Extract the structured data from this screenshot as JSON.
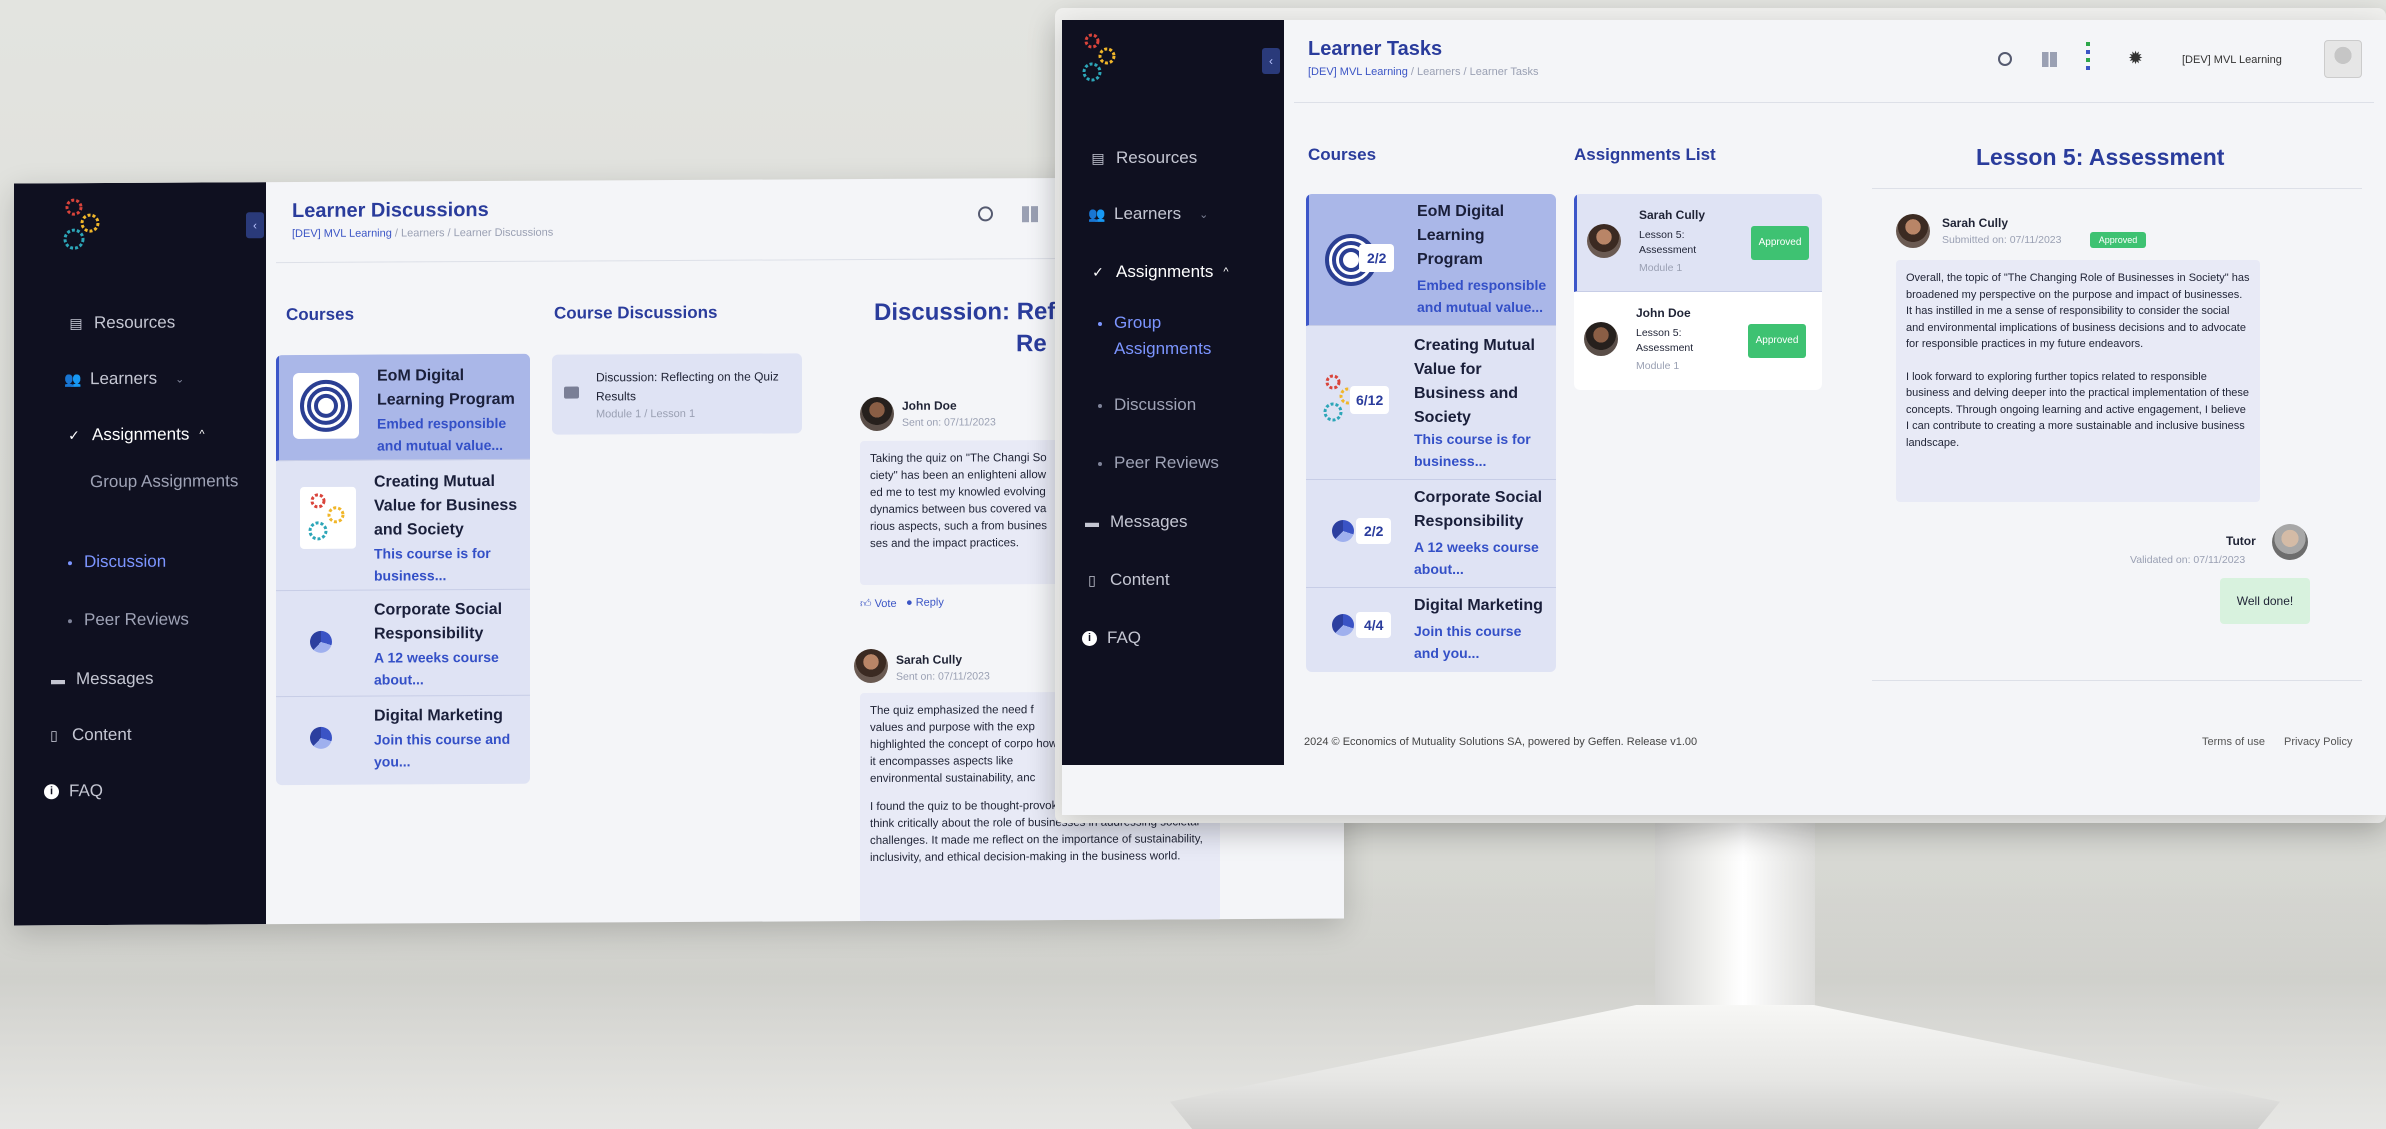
{
  "left": {
    "title": "Learner Discussions",
    "breadcrumb": {
      "root": "[DEV] MVL Learning",
      "rest": " / Learners / Learner Discussions"
    },
    "nav": {
      "resources": "Resources",
      "learners": "Learners",
      "assignments": "Assignments",
      "group_assignments": "Group Assignments",
      "discussion": "Discussion",
      "peer_reviews": "Peer Reviews",
      "messages": "Messages",
      "content": "Content",
      "faq": "FAQ"
    },
    "courses_title": "Courses",
    "courses": [
      {
        "name": "EoM Digital Learning Program",
        "desc": "Embed responsible and mutual value..."
      },
      {
        "name": "Creating Mutual Value for Business and Society",
        "desc": "This course is for business..."
      },
      {
        "name": "Corporate Social Responsibility",
        "desc": "A 12 weeks course about..."
      },
      {
        "name": "Digital Marketing",
        "desc": "Join this course and you..."
      }
    ],
    "discussions_title": "Course Discussions",
    "discussion_item": {
      "title": "Discussion: Reflecting on the Quiz Results",
      "sub": "Module 1 / Lesson 1"
    },
    "detail_title_1": "Discussion: Ref",
    "detail_title_2": "Re",
    "post1": {
      "name": "John Doe",
      "sent": "Sent on: 07/11/2023",
      "text": "Taking the quiz on \"The Changi Society\" has been an enlighteni allowed me to test my knowled evolving dynamics between bus covered various aspects, such a from businesses and the impact practices."
    },
    "vote": "Vote",
    "reply": "Reply",
    "post2": {
      "name": "Sarah Cully",
      "sent": "Sent on: 07/11/2023",
      "text": "The quiz emphasized the need f values and purpose with the exp highlighted the concept of corpo how it encompasses aspects like environmental sustainability, anc",
      "text2": "I found the quiz to be thought-provoking as it challenged me to think critically about the role of businesses in addressing societal challenges. It made me reflect on the importance of sustainability, inclusivity, and ethical decision-making in the business world."
    }
  },
  "right": {
    "title": "Learner Tasks",
    "breadcrumb": {
      "root": "[DEV] MVL Learning",
      "rest": " / Learners / Learner Tasks"
    },
    "org_label": "[DEV] MVL Learning",
    "nav": {
      "resources": "Resources",
      "learners": "Learners",
      "assignments": "Assignments",
      "group_assignments": "Group Assignments",
      "discussion": "Discussion",
      "peer_reviews": "Peer Reviews",
      "messages": "Messages",
      "content": "Content",
      "faq": "FAQ"
    },
    "courses_title": "Courses",
    "courses": [
      {
        "badge": "2/2",
        "name": "EoM Digital Learning Program",
        "desc": "Embed responsible and mutual value..."
      },
      {
        "badge": "6/12",
        "name": "Creating Mutual Value for Business and Society",
        "desc": "This course is for business..."
      },
      {
        "badge": "2/2",
        "name": "Corporate Social Responsibility",
        "desc": "A 12 weeks course about..."
      },
      {
        "badge": "4/4",
        "name": "Digital Marketing",
        "desc": "Join this course and you..."
      }
    ],
    "assignments_title": "Assignments List",
    "assignments": [
      {
        "name": "Sarah Cully",
        "lesson": "Lesson 5: Assessment",
        "module": "Module 1",
        "status": "Approved"
      },
      {
        "name": "John Doe",
        "lesson": "Lesson 5: Assessment",
        "module": "Module 1",
        "status": "Approved"
      }
    ],
    "lesson_title": "Lesson 5: Assessment",
    "submission": {
      "name": "Sarah Cully",
      "submitted": "Submitted on: 07/11/2023",
      "status": "Approved",
      "p1": "Overall, the topic of \"The Changing Role of Businesses in Society\" has broadened my perspective on the purpose and impact of businesses. It has instilled in me a sense of responsibility to consider the social and environmental implications of business decisions and to advocate for responsible practices in my future endeavors.",
      "p2": "I look forward to exploring further topics related to responsible business and delving deeper into the practical implementation of these concepts. Through ongoing learning and active engagement, I believe I can contribute to creating a more sustainable and inclusive business landscape."
    },
    "tutor": {
      "name": "Tutor",
      "validated": "Validated on: 07/11/2023",
      "reply": "Well done!"
    },
    "footer": {
      "copyright": "2024 © Economics of Mutuality Solutions SA, powered by Geffen. Release v1.00",
      "terms": "Terms of use",
      "privacy": "Privacy Policy"
    }
  }
}
